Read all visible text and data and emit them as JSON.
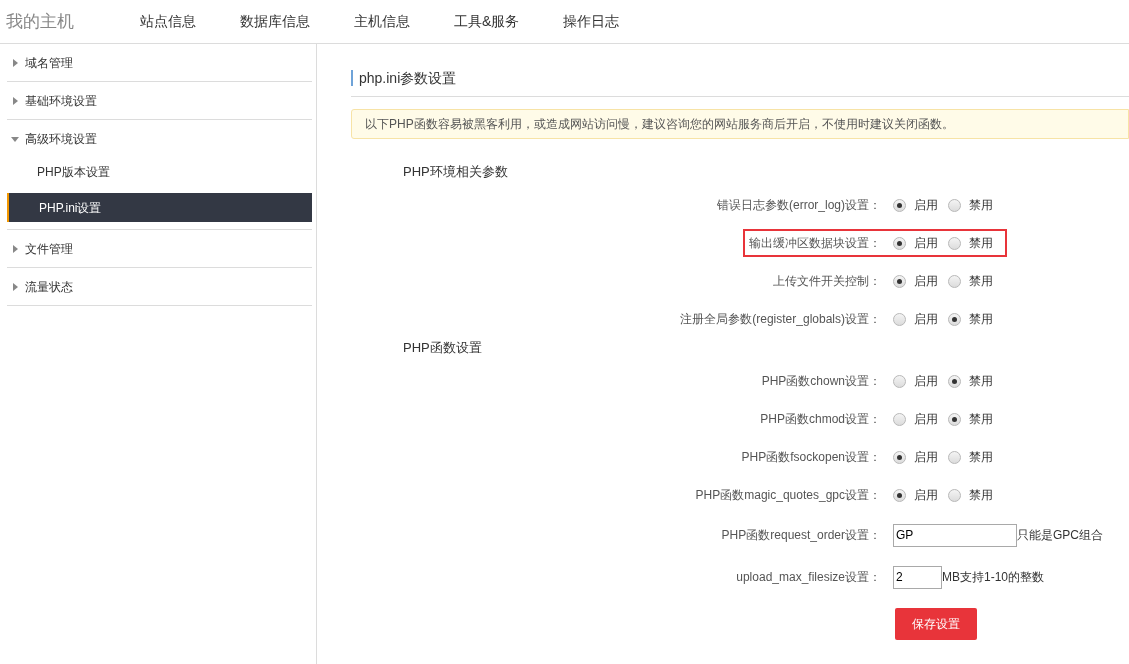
{
  "brand": "我的主机",
  "nav": [
    {
      "label": "站点信息",
      "selected": false
    },
    {
      "label": "数据库信息",
      "selected": false
    },
    {
      "label": "主机信息",
      "selected": false
    },
    {
      "label": "工具&服务",
      "selected": false
    },
    {
      "label": "操作日志",
      "selected": false
    }
  ],
  "sidebar": {
    "items": [
      {
        "label": "域名管理",
        "expanded": false
      },
      {
        "label": "基础环境设置",
        "expanded": false
      },
      {
        "label": "高级环境设置",
        "expanded": true,
        "children": [
          {
            "label": "PHP版本设置",
            "selected": false
          },
          {
            "label": "PHP.ini设置",
            "selected": true
          }
        ]
      },
      {
        "label": "文件管理",
        "expanded": false
      },
      {
        "label": "流量状态",
        "expanded": false
      }
    ]
  },
  "page_title": "php.ini参数设置",
  "notice": "以下PHP函数容易被黑客利用，或造成网站访问慢，建议咨询您的网站服务商后开启，不使用时建议关闭函数。",
  "sections": [
    {
      "title": "PHP环境相关参数",
      "rows": [
        {
          "kind": "radio",
          "label": "错误日志参数(error_log)设置：",
          "highlighted": false,
          "options": [
            {
              "label": "启用",
              "selected": true
            },
            {
              "label": "禁用",
              "selected": false
            }
          ]
        },
        {
          "kind": "radio",
          "label": "输出缓冲区数据块设置：",
          "highlighted": true,
          "options": [
            {
              "label": "启用",
              "selected": true
            },
            {
              "label": "禁用",
              "selected": false
            }
          ]
        },
        {
          "kind": "radio",
          "label": "上传文件开关控制：",
          "highlighted": false,
          "options": [
            {
              "label": "启用",
              "selected": true
            },
            {
              "label": "禁用",
              "selected": false
            }
          ]
        },
        {
          "kind": "radio",
          "label": "注册全局参数(register_globals)设置：",
          "highlighted": false,
          "options": [
            {
              "label": "启用",
              "selected": false
            },
            {
              "label": "禁用",
              "selected": true
            }
          ]
        }
      ]
    },
    {
      "title": "PHP函数设置",
      "rows": [
        {
          "kind": "radio",
          "label": "PHP函数chown设置：",
          "highlighted": false,
          "options": [
            {
              "label": "启用",
              "selected": false
            },
            {
              "label": "禁用",
              "selected": true
            }
          ]
        },
        {
          "kind": "radio",
          "label": "PHP函数chmod设置：",
          "highlighted": false,
          "options": [
            {
              "label": "启用",
              "selected": false
            },
            {
              "label": "禁用",
              "selected": true
            }
          ]
        },
        {
          "kind": "radio",
          "label": "PHP函数fsockopen设置：",
          "highlighted": false,
          "options": [
            {
              "label": "启用",
              "selected": true
            },
            {
              "label": "禁用",
              "selected": false
            }
          ]
        },
        {
          "kind": "radio",
          "label": "PHP函数magic_quotes_gpc设置：",
          "highlighted": false,
          "options": [
            {
              "label": "启用",
              "selected": true
            },
            {
              "label": "禁用",
              "selected": false
            }
          ]
        },
        {
          "kind": "text",
          "label": "PHP函数request_order设置：",
          "highlighted": false,
          "value": "GP",
          "hint": "只能是GPC组合"
        },
        {
          "kind": "number",
          "label": "upload_max_filesize设置：",
          "highlighted": false,
          "value": "2",
          "hint": "MB支持1-10的整数"
        }
      ]
    }
  ],
  "save_button": "保存设置"
}
